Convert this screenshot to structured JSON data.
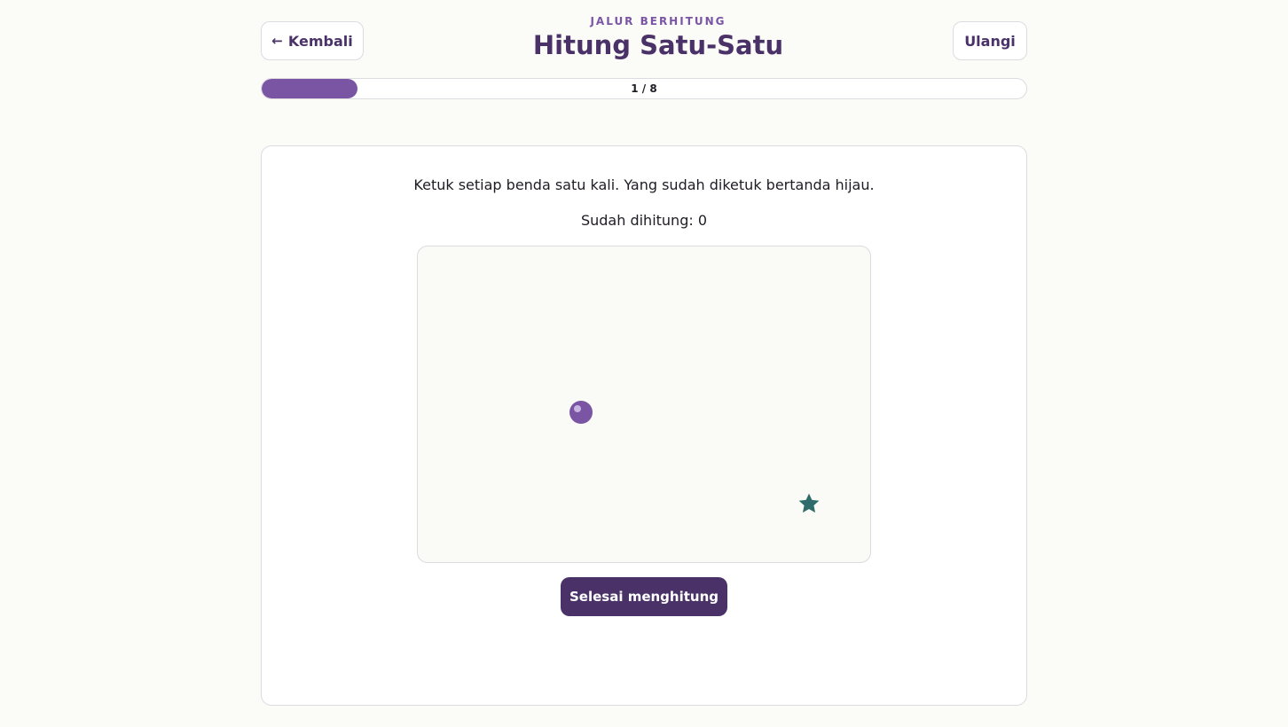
{
  "header": {
    "back_label": "Kembali",
    "back_arrow": "←",
    "eyebrow": "JALUR BERHITUNG",
    "title": "Hitung Satu-Satu",
    "reset_label": "Ulangi"
  },
  "progress": {
    "label": "1 / 8",
    "current": 1,
    "total": 8,
    "fraction": 0.125
  },
  "activity": {
    "instruction": "Ketuk setiap benda satu kali. Yang sudah diketuk bertanda hijau.",
    "counted_text": "Sudah dihitung: 0",
    "objects": [
      {
        "kind": "ball",
        "icon": "ball-icon",
        "color": "#7a55a3",
        "counted": false
      },
      {
        "kind": "star",
        "icon": "star-icon",
        "color": "#2e6b6a",
        "counted": false
      }
    ],
    "finish_label": "Selesai menghitung"
  },
  "colors": {
    "accent": "#7a55a3",
    "primary": "#4a3268",
    "counted": "#3aa655",
    "star": "#2e6b6a"
  }
}
